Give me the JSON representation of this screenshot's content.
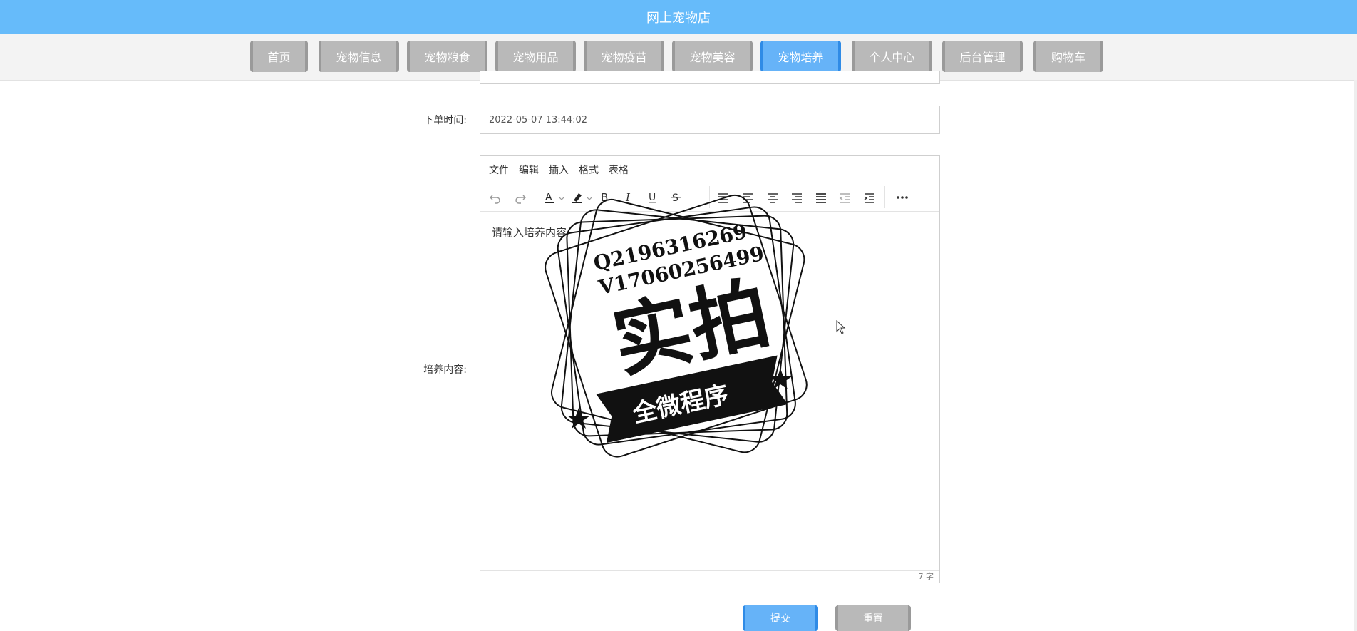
{
  "header": {
    "title": "网上宠物店"
  },
  "nav": {
    "items": [
      {
        "label": "首页"
      },
      {
        "label": "宠物信息"
      },
      {
        "label": "宠物粮食"
      },
      {
        "label": "宠物用品"
      },
      {
        "label": "宠物疫苗"
      },
      {
        "label": "宠物美容"
      },
      {
        "label": "宠物培养",
        "active": true
      },
      {
        "label": "个人中心"
      },
      {
        "label": "后台管理"
      },
      {
        "label": "购物车"
      }
    ]
  },
  "form": {
    "order_time_label": "下单时间:",
    "order_time_value": "2022-05-07 13:44:02",
    "content_label": "培养内容:",
    "editor": {
      "menu": [
        "文件",
        "编辑",
        "插入",
        "格式",
        "表格"
      ],
      "placeholder": "请输入培养内容",
      "word_count": "7 字",
      "toolbar_icons": [
        "undo-icon",
        "redo-icon",
        "font-color-icon",
        "chevron-down-icon",
        "highlight-icon",
        "chevron-down-icon",
        "bold-icon",
        "italic-icon",
        "underline-icon",
        "strikethrough-icon",
        "list-icon",
        "align-left-icon",
        "align-center-icon",
        "align-right-icon",
        "align-justify-icon",
        "outdent-icon",
        "indent-icon",
        "more-icon"
      ]
    },
    "submit_label": "提交",
    "reset_label": "重置"
  },
  "watermark": {
    "line1": "Q2196316269",
    "line2": "V17060256499",
    "main": "实拍",
    "ribbon": "全微程序"
  },
  "colors": {
    "header_bg": "#66bbfa",
    "active_nav": "#66b3f8",
    "nav_btn": "#b9b9b9"
  }
}
